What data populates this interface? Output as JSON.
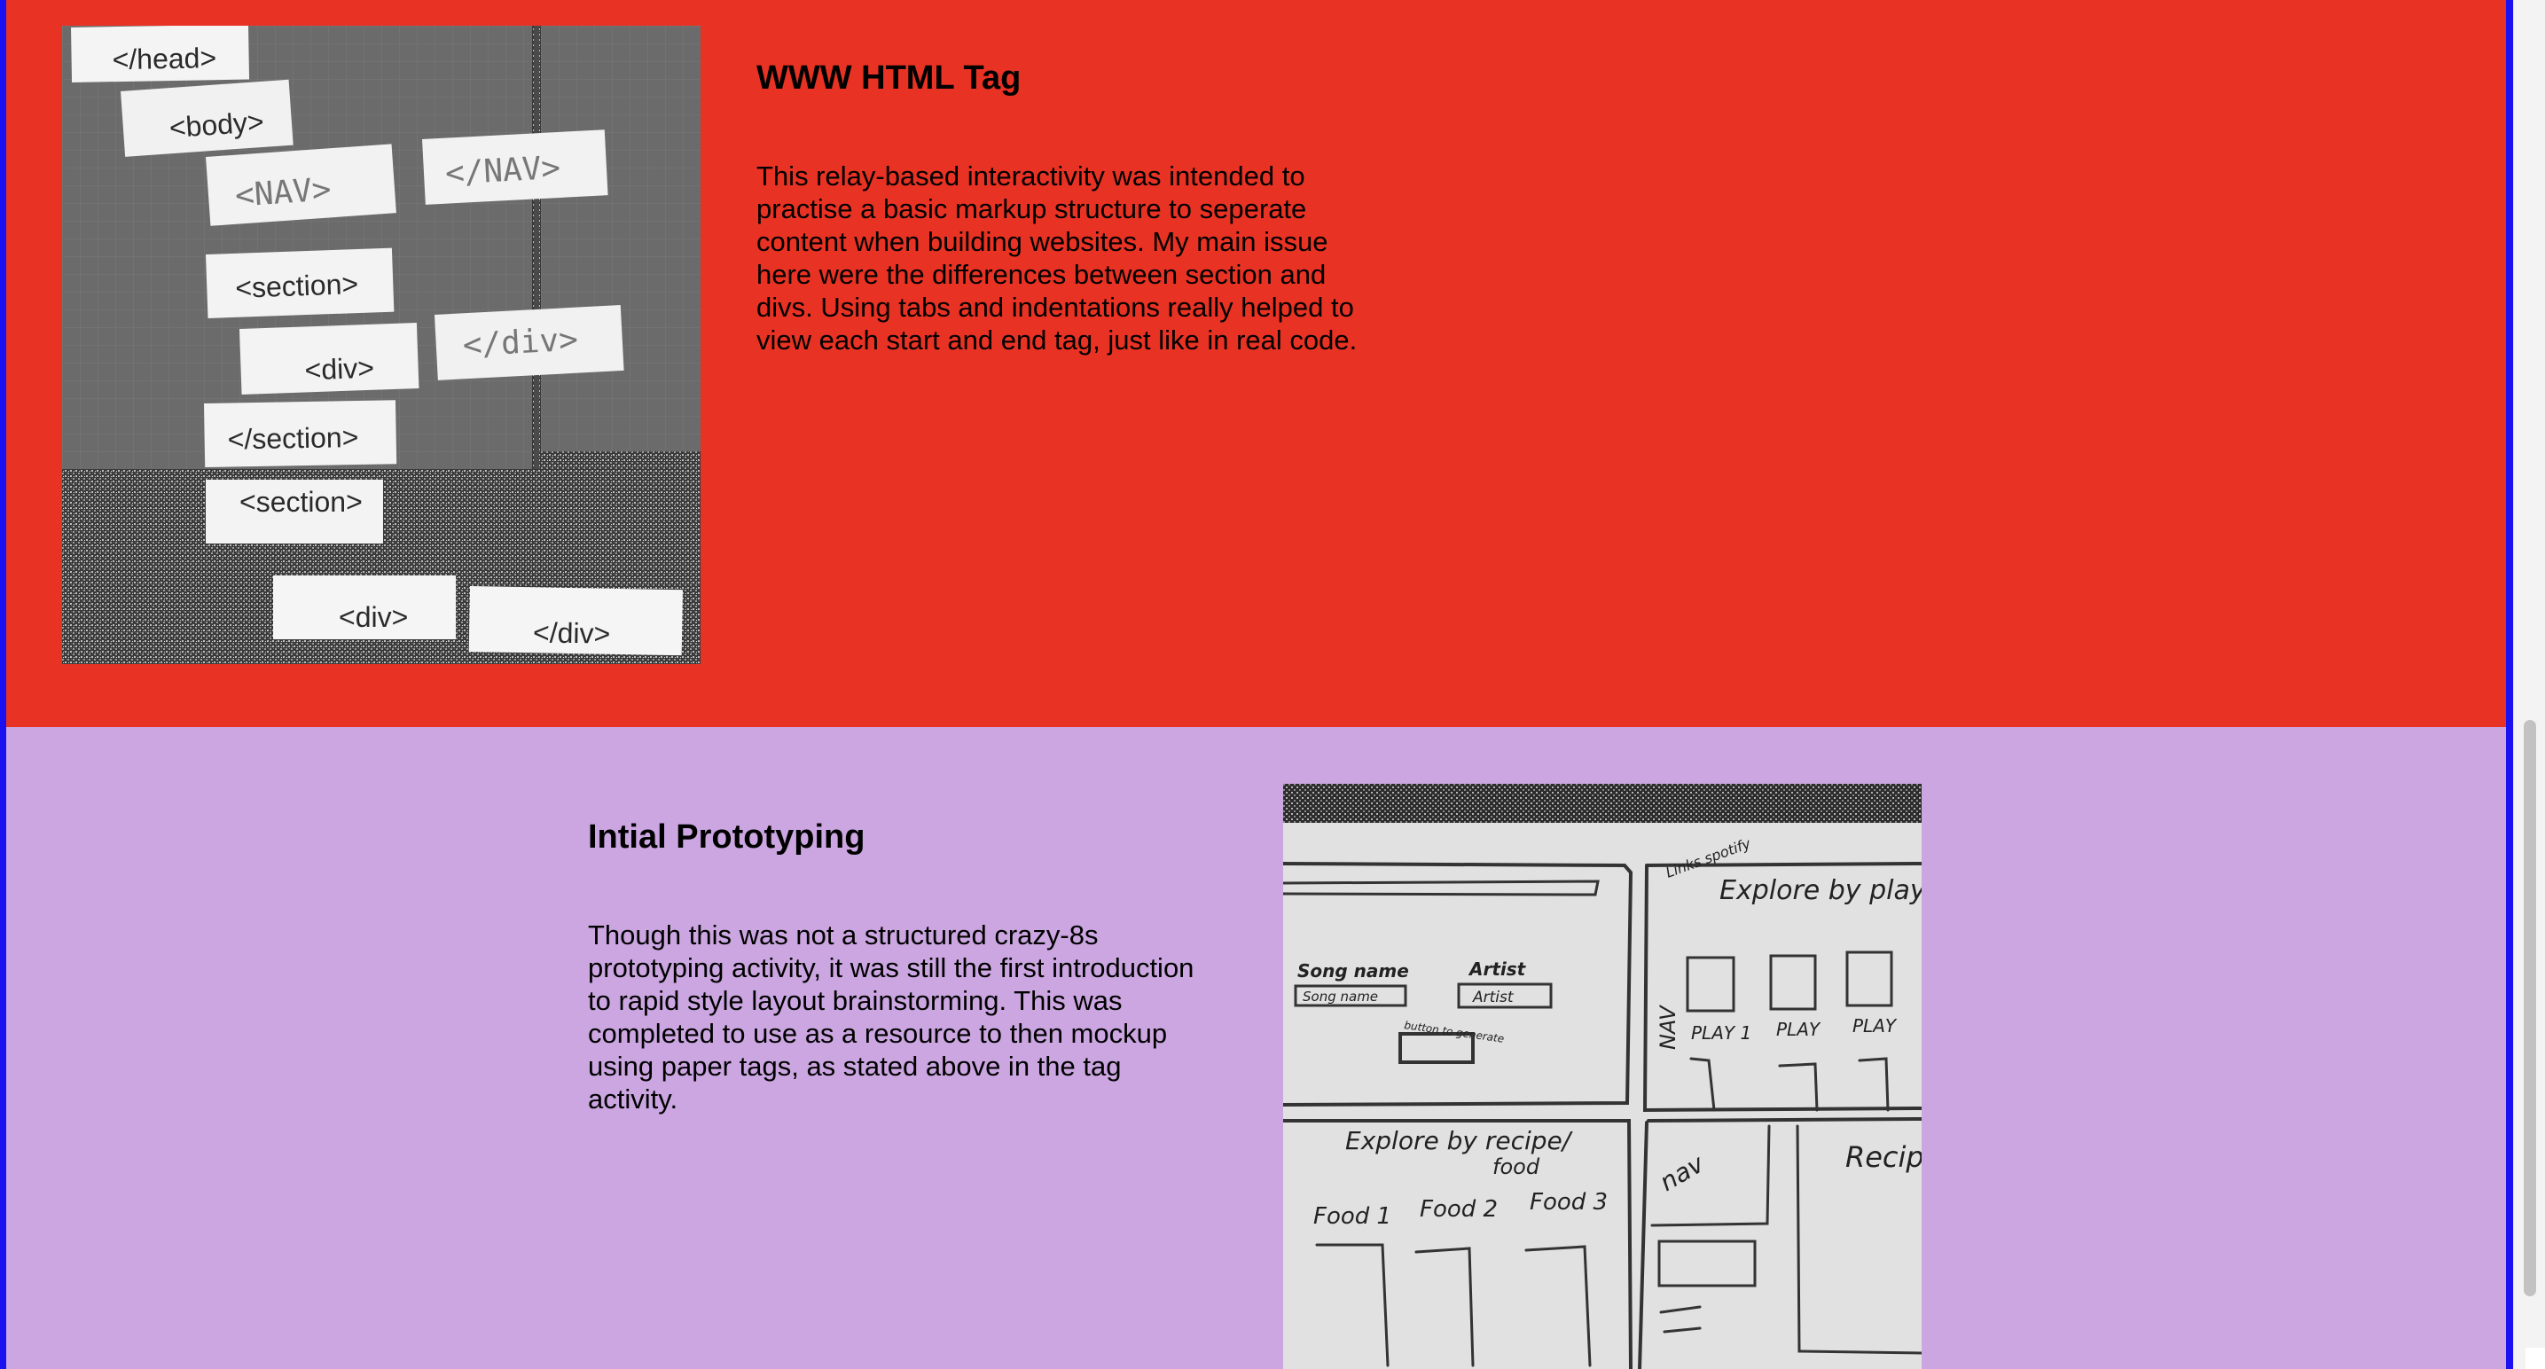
{
  "sections": [
    {
      "heading": "WWW HTML Tag",
      "body": "This relay-based interactivity was intended to practise a basic markup structure to seperate content when building websites. My main issue here were the differences between section and divs. Using tabs and indentations really helped to view each start and end tag, just like in real code.",
      "body_lines": [
        "This relay-based interactivity was intended to",
        "practise a basic markup structure to seperate",
        "content when building websites. My main issue",
        "here were the differences between section and",
        "divs. Using tabs and indentations really helped to",
        "view each start and end tag, just like in real code."
      ],
      "background": "#e83223",
      "photo": {
        "cards": [
          "</head>",
          "<body>",
          "<NAV>",
          "</NAV>",
          "<section>",
          "<div>",
          "</div>",
          "</section>",
          "<section>",
          "<div>",
          "</div>"
        ]
      }
    },
    {
      "heading": "Intial Prototyping",
      "body": "Though this was not a structured crazy-8s prototyping activity, it was still the first introduction to rapid style layout brainstorming. This was completed to use as a resource to then mockup using paper tags, as stated above in the tag activity.",
      "body_lines": [
        "Though this was not a structured crazy-8s",
        "prototyping activity, it was still the first introduction",
        "to rapid style layout brainstorming. This was",
        "completed to use as a resource to then mockup",
        "using paper tags, as stated above in the tag",
        "activity."
      ],
      "background": "#cba6e1",
      "photo": {
        "sketch_text": {
          "explore_by_play": "Explore by play",
          "links_spotify": "Links spotify",
          "song_name": "Song name",
          "artist": "Artist",
          "artist_box": "Artist",
          "song_name_box": "Song name",
          "button_generate": "button to generate",
          "nav_vertical": "NAV",
          "play1": "PLAY 1",
          "play2": "PLAY",
          "play3": "PLAY",
          "explore_by_recipe": "Explore by recipe/",
          "food": "food",
          "food1": "Food 1",
          "food2": "Food 2",
          "food3": "Food 3",
          "nav2": "nav",
          "recipe": "Recipe"
        }
      }
    }
  ],
  "colors": {
    "frame": "#1b10f0",
    "red_section": "#e83223",
    "lilac_section": "#cba6e1",
    "text": "#000000"
  },
  "icons": [
    "scrollbar"
  ]
}
